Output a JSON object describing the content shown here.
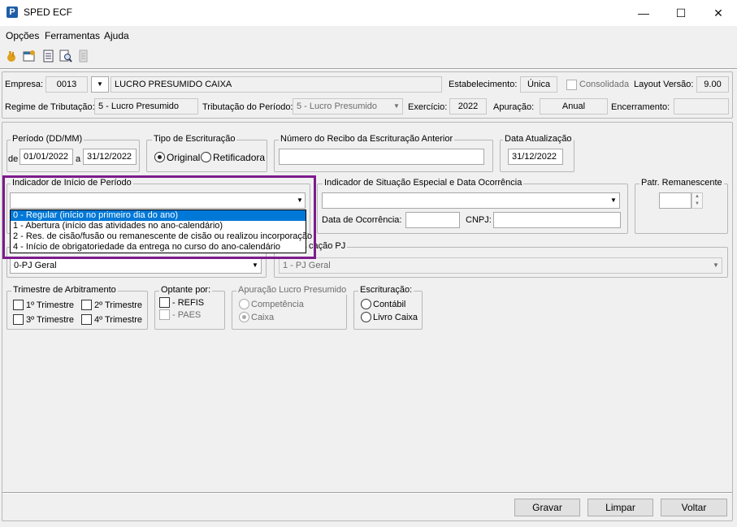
{
  "window": {
    "title": "SPED ECF",
    "app_icon": "P",
    "min": "—",
    "max": "☐",
    "close": "✕"
  },
  "menu": [
    "Opções",
    "Ferramentas",
    "Ajuda"
  ],
  "toolbar": [
    "hand-icon",
    "properties-icon",
    "document-icon",
    "search-doc-icon",
    "report-icon"
  ],
  "header": {
    "empresa_label": "Empresa:",
    "empresa_code": "0013",
    "empresa_name": "LUCRO PRESUMIDO CAIXA",
    "estabelecimento_label": "Estabelecimento:",
    "estabelecimento": "Única",
    "consolidada_label": "Consolidada",
    "layout_label": "Layout Versão:",
    "layout": "9.00",
    "regime_label": "Regime de Tributação:",
    "regime": "5 - Lucro Presumido",
    "trib_label": "Tributação do Período:",
    "trib": "5 - Lucro Presumido",
    "exercicio_label": "Exercício:",
    "exercicio": "2022",
    "apuracao_label": "Apuração:",
    "apuracao": "Anual",
    "encerramento_label": "Encerramento:",
    "encerramento": ""
  },
  "periodo": {
    "title": "Período (DD/MM)",
    "de": "de",
    "a": "a",
    "start": "01/01/2022",
    "end": "31/12/2022"
  },
  "tipo": {
    "title": "Tipo de Escrituração",
    "original": "Original",
    "retificadora": "Retificadora"
  },
  "recibo": {
    "title": "Número do Recibo da Escrituração Anterior",
    "value": ""
  },
  "data_atual": {
    "title": "Data Atualização",
    "value": "31/12/2022"
  },
  "indicador_inicio": {
    "title": "Indicador de Início de Período",
    "options": [
      "0 - Regular (início no primeiro dia do ano)",
      "1 - Abertura (início das atividades no ano-calendário)",
      "2 - Res. de cisão/fusão ou remanescente de cisão ou realizou incorporação",
      "4 - Início de obrigatoriedade da entrega no curso do ano-calendário"
    ]
  },
  "situacao": {
    "title": "Indicador de Situação Especial e Data Ocorrência",
    "data_label": "Data de Ocorrência:",
    "cnpj_label": "CNPJ:"
  },
  "patr": {
    "title": "Patr. Remanescente"
  },
  "qualif": {
    "left_value": "0-PJ Geral",
    "right_title": "cação PJ",
    "right_value": "1 - PJ Geral"
  },
  "trimestre": {
    "title": "Trimestre de Arbitramento",
    "t1": "1º Trimestre",
    "t2": "2º Trimestre",
    "t3": "3º Trimestre",
    "t4": "4º Trimestre"
  },
  "optante": {
    "title": "Optante por:",
    "refis": "- REFIS",
    "paes": "- PAES"
  },
  "apuracao_lp": {
    "title": "Apuração Lucro Presumido",
    "competencia": "Competência",
    "caixa": "Caixa"
  },
  "escrituracao": {
    "title": "Escrituração:",
    "contabil": "Contábil",
    "livro": "Livro Caixa"
  },
  "buttons": {
    "gravar": "Gravar",
    "limpar": "Limpar",
    "voltar": "Voltar"
  }
}
